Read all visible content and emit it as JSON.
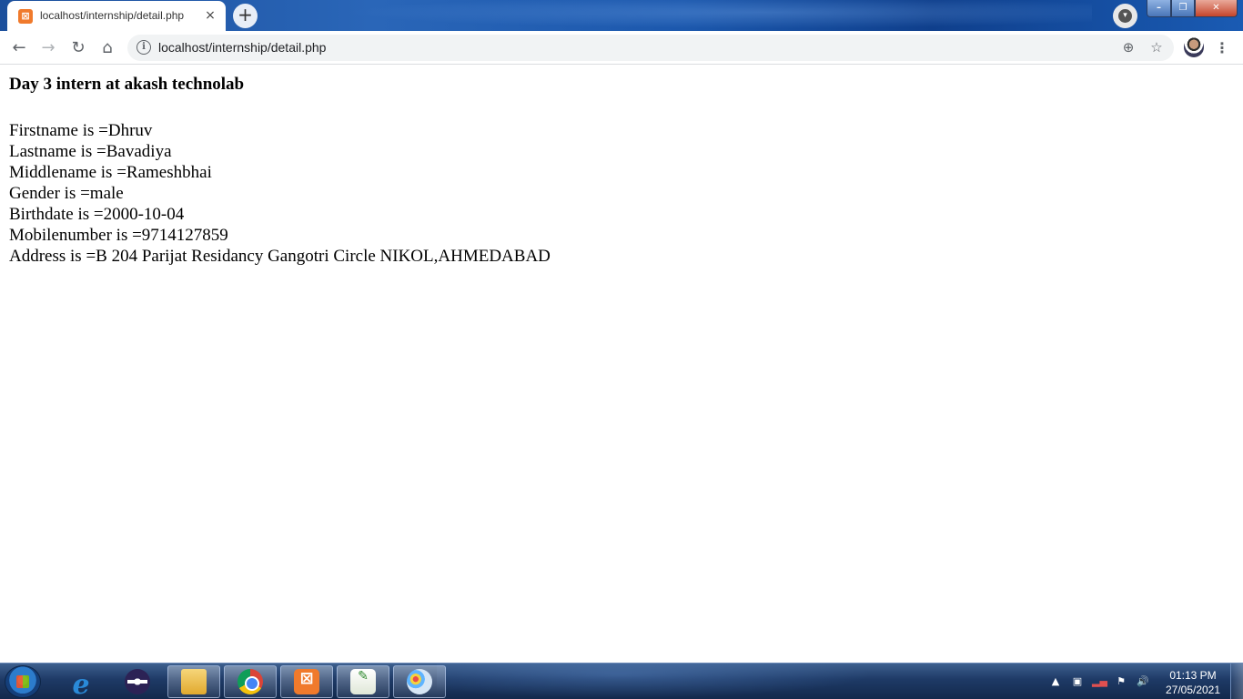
{
  "browser": {
    "tab": {
      "favicon": "xampp-icon",
      "title": "localhost/internship/detail.php",
      "close": "×"
    },
    "new_tab": "+",
    "window_controls": {
      "minimize": "–",
      "maximize": "❐",
      "close": "✕"
    },
    "toolbar": {
      "back": "←",
      "forward": "→",
      "reload": "↻",
      "home": "⌂",
      "site_info": "i",
      "url": "localhost/internship/detail.php",
      "zoom": "⊕",
      "bookmark": "☆",
      "menu": "⋮"
    }
  },
  "page": {
    "heading": "Day 3 intern at akash technolab",
    "lines": [
      "Firstname is =Dhruv",
      "Lastname is =Bavadiya",
      "Middlename is =Rameshbhai",
      "Gender is =male",
      "Birthdate is =2000-10-04",
      "Mobilenumber is =9714127859",
      "Address is =B 204 Parijat Residancy Gangotri Circle NIKOL,AHMEDABAD"
    ]
  },
  "taskbar": {
    "pinned": [
      "internet-explorer-icon",
      "eclipse-icon",
      "windows-explorer-icon",
      "chrome-icon",
      "xampp-icon",
      "notepad-plus-plus-icon",
      "paint-icon"
    ],
    "tray": {
      "overflow": "▲",
      "network": "signal-icon",
      "flag": "action-center-icon",
      "volume": "speaker-icon"
    },
    "clock": {
      "time": "01:13 PM",
      "date": "27/05/2021"
    }
  }
}
